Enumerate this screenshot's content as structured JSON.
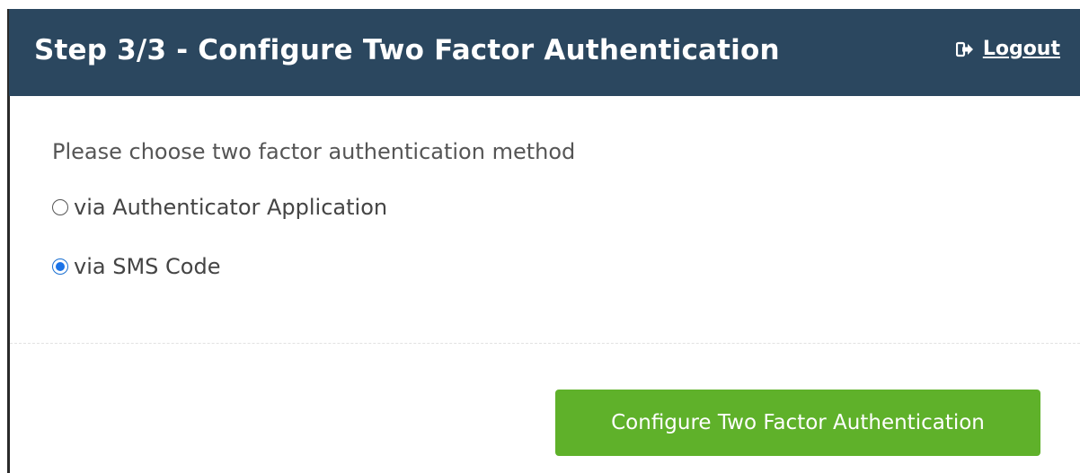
{
  "header": {
    "title": "Step 3/3 - Configure Two Factor Authentication",
    "logout_label": "Logout",
    "logout_icon": "logout-icon"
  },
  "form": {
    "prompt": "Please choose two factor authentication method",
    "options": [
      {
        "label": "via Authenticator Application",
        "selected": false
      },
      {
        "label": "via SMS Code",
        "selected": true
      }
    ],
    "submit_label": "Configure Two Factor Authentication"
  },
  "colors": {
    "header_bg": "#2b475f",
    "button_bg": "#5fb12a",
    "radio_selected": "#1a73e8"
  }
}
